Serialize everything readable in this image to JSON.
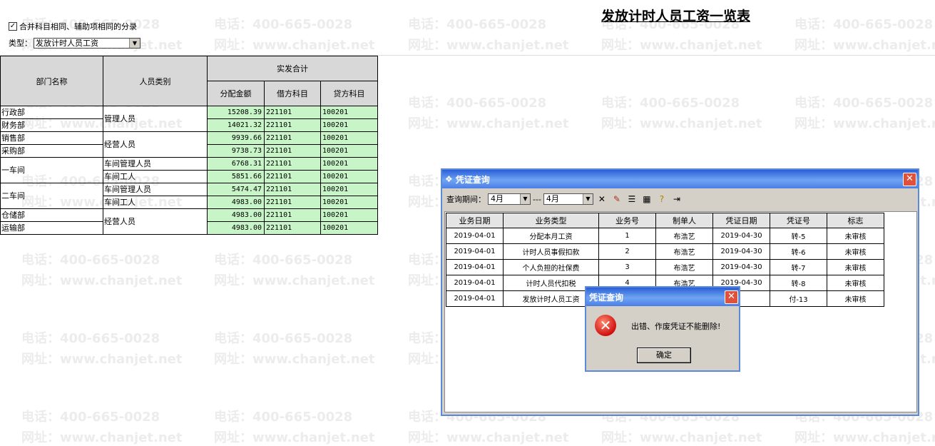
{
  "page_title": "发放计时人员工资一览表",
  "watermark": {
    "phone": "电话：400-665-0028",
    "site": "网址：www.chanjet.net"
  },
  "options": {
    "merge_checked": true,
    "merge_label": "合并科目相同、辅助项相同的分录",
    "type_label": "类型：",
    "type_value": "发放计时人员工资"
  },
  "table": {
    "headers": {
      "dept": "部门名称",
      "category": "人员类别",
      "group": "实发合计",
      "amount": "分配金额",
      "debit": "借方科目",
      "credit": "贷方科目"
    },
    "rows": [
      {
        "dept": "行政部",
        "amount": "15208.39",
        "debit": "221101",
        "credit": "100201"
      },
      {
        "dept": "财务部",
        "amount": "14021.32",
        "debit": "221101",
        "credit": "100201"
      },
      {
        "dept": "销售部",
        "amount": "9939.66",
        "debit": "221101",
        "credit": "100201"
      },
      {
        "dept": "采购部",
        "amount": "9738.73",
        "debit": "221101",
        "credit": "100201"
      },
      {
        "dept": "一车间",
        "amount": "6768.31",
        "debit": "221101",
        "credit": "100201"
      },
      {
        "dept": "",
        "amount": "5851.66",
        "debit": "221101",
        "credit": "100201"
      },
      {
        "dept": "二车间",
        "amount": "5474.47",
        "debit": "221101",
        "credit": "100201"
      },
      {
        "dept": "",
        "amount": "4983.00",
        "debit": "221101",
        "credit": "100201"
      },
      {
        "dept": "仓储部",
        "amount": "4983.00",
        "debit": "221101",
        "credit": "100201"
      },
      {
        "dept": "运输部",
        "amount": "4983.00",
        "debit": "221101",
        "credit": "100201"
      }
    ],
    "categories": [
      "管理人员",
      "经营人员",
      "车间管理人员",
      "车间工人",
      "车间管理人员",
      "车间工人",
      "经营人员"
    ]
  },
  "dialog": {
    "title": "凭证查询",
    "period_label": "查询期间：",
    "from": "4月",
    "sep": "---",
    "to": "4月",
    "columns": [
      "业务日期",
      "业务类型",
      "业务号",
      "制单人",
      "凭证日期",
      "凭证号",
      "标志"
    ],
    "rows": [
      [
        "2019-04-01",
        "分配本月工资",
        "1",
        "布浩艺",
        "2019-04-30",
        "转-5",
        "未审核"
      ],
      [
        "2019-04-01",
        "计时人员事假扣款",
        "2",
        "布浩艺",
        "2019-04-30",
        "转-6",
        "未审核"
      ],
      [
        "2019-04-01",
        "个人负担的社保费",
        "3",
        "布浩艺",
        "2019-04-30",
        "转-7",
        "未审核"
      ],
      [
        "2019-04-01",
        "计时人员代扣税",
        "4",
        "布浩艺",
        "2019-04-30",
        "转-8",
        "未审核"
      ],
      [
        "2019-04-01",
        "发放计时人员工资",
        "",
        "",
        "",
        "付-13",
        "未审核"
      ]
    ]
  },
  "message": {
    "title": "凭证查询",
    "text": "出错、作废凭证不能删除!",
    "ok": "确定"
  }
}
